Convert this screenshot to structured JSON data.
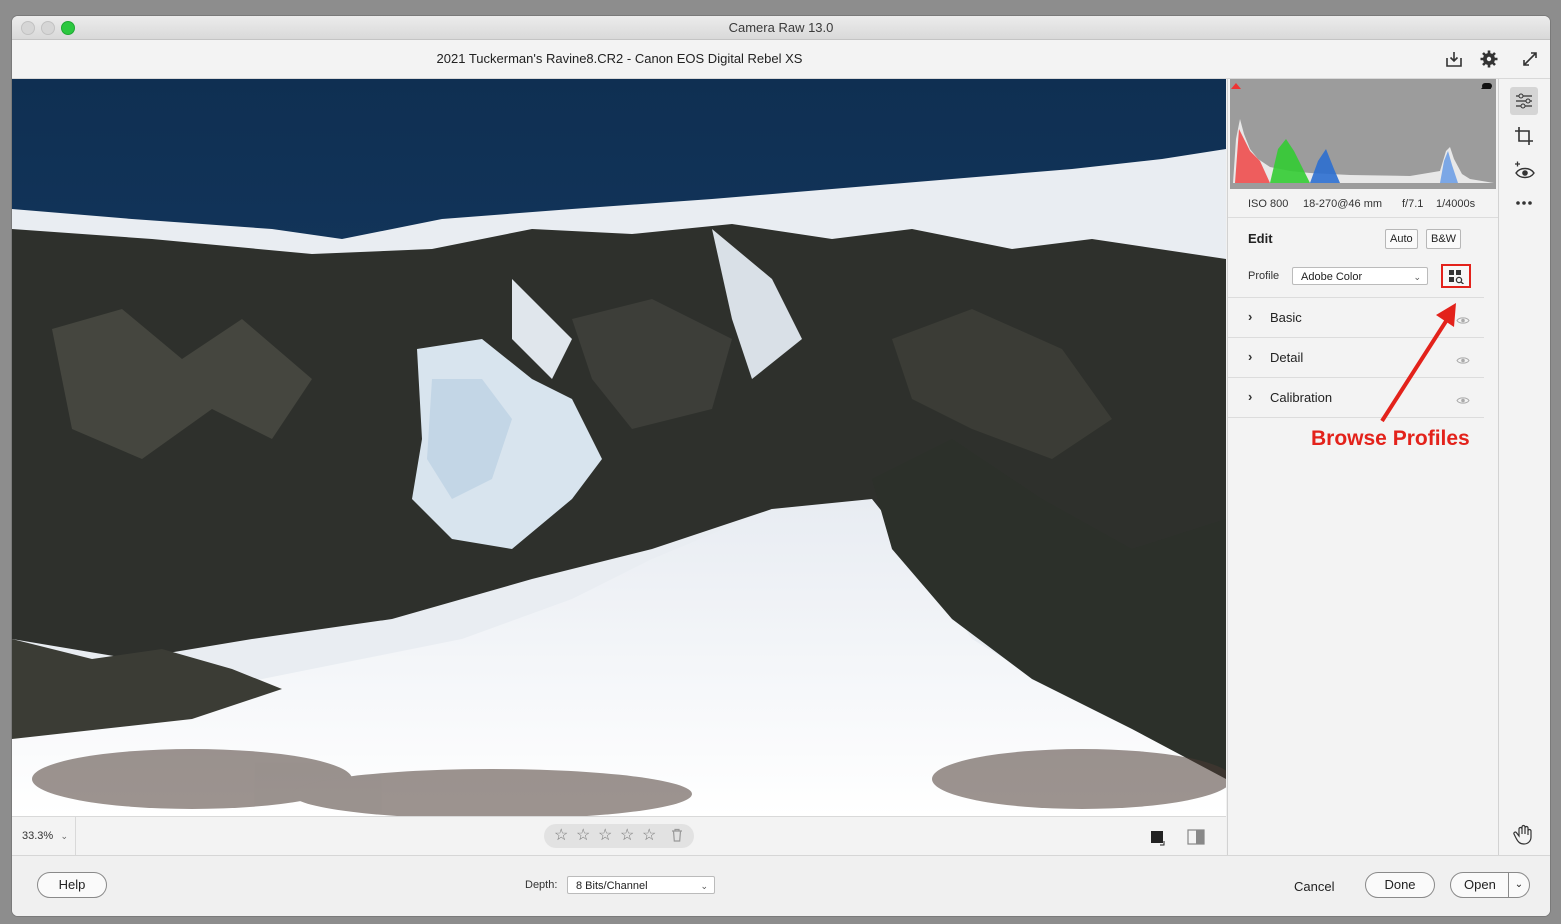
{
  "window": {
    "title": "Camera Raw 13.0"
  },
  "header": {
    "file_title": "2021 Tuckerman's Ravine8.CR2  -  Canon EOS Digital Rebel XS"
  },
  "filmbar": {
    "zoom": "33.3%"
  },
  "exif": {
    "iso": "ISO 800",
    "lens": "18-270@46 mm",
    "aperture": "f/7.1",
    "shutter": "1/4000s"
  },
  "edit": {
    "title": "Edit",
    "auto_label": "Auto",
    "bw_label": "B&W",
    "profile_label": "Profile",
    "profile_value": "Adobe Color"
  },
  "sections": [
    {
      "label": "Basic"
    },
    {
      "label": "Detail"
    },
    {
      "label": "Calibration"
    }
  ],
  "annotation": {
    "label": "Browse Profiles",
    "color": "#e3221b"
  },
  "bottom": {
    "help_label": "Help",
    "depth_label": "Depth:",
    "depth_value": "8 Bits/Channel",
    "cancel_label": "Cancel",
    "done_label": "Done",
    "open_label": "Open"
  },
  "icons": [
    "save-icon",
    "gear-icon",
    "fullscreen-icon",
    "edit-sliders-icon",
    "crop-icon",
    "redeye-icon",
    "more-icon",
    "hand-icon",
    "star-icon",
    "trash-icon",
    "before-after-icon",
    "browse-profiles-icon",
    "eye-icon"
  ]
}
